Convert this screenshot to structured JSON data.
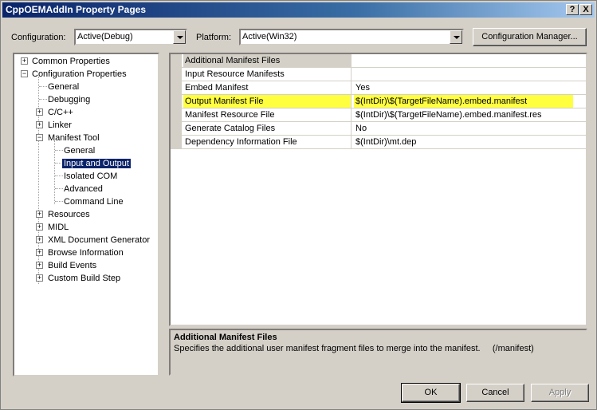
{
  "window": {
    "title": "CppOEMAddIn Property Pages",
    "help_glyph": "?",
    "close_glyph": "X"
  },
  "toolbar": {
    "configuration_label": "Configuration:",
    "configuration_value": "Active(Debug)",
    "platform_label": "Platform:",
    "platform_value": "Active(Win32)",
    "config_manager_label": "Configuration Manager..."
  },
  "tree": {
    "common_properties": "Common Properties",
    "configuration_properties": "Configuration Properties",
    "general": "General",
    "debugging": "Debugging",
    "cpp": "C/C++",
    "linker": "Linker",
    "manifest_tool": "Manifest Tool",
    "mt_general": "General",
    "mt_input_output": "Input and Output",
    "mt_isolated_com": "Isolated COM",
    "mt_advanced": "Advanced",
    "mt_command_line": "Command Line",
    "resources": "Resources",
    "midl": "MIDL",
    "xml_doc_gen": "XML Document Generator",
    "browse_info": "Browse Information",
    "build_events": "Build Events",
    "custom_build_step": "Custom Build Step",
    "expand_glyph": "+",
    "collapse_glyph": "−"
  },
  "properties": [
    {
      "name": "Additional Manifest Files",
      "value": ""
    },
    {
      "name": "Input Resource Manifests",
      "value": ""
    },
    {
      "name": "Embed Manifest",
      "value": "Yes"
    },
    {
      "name": "Output Manifest File",
      "value": "$(IntDir)\\$(TargetFileName).embed.manifest"
    },
    {
      "name": "Manifest Resource File",
      "value": "$(IntDir)\\$(TargetFileName).embed.manifest.res"
    },
    {
      "name": "Generate Catalog Files",
      "value": "No"
    },
    {
      "name": "Dependency Information File",
      "value": "$(IntDir)\\mt.dep"
    }
  ],
  "description": {
    "title": "Additional Manifest Files",
    "text": "Specifies the additional user manifest fragment files to merge into the manifest.     (/manifest)"
  },
  "buttons": {
    "ok": "OK",
    "cancel": "Cancel",
    "apply": "Apply"
  },
  "colors": {
    "titlebar": "#0a246a",
    "highlight_row": "#ffff40",
    "selection": "#0a246a"
  }
}
